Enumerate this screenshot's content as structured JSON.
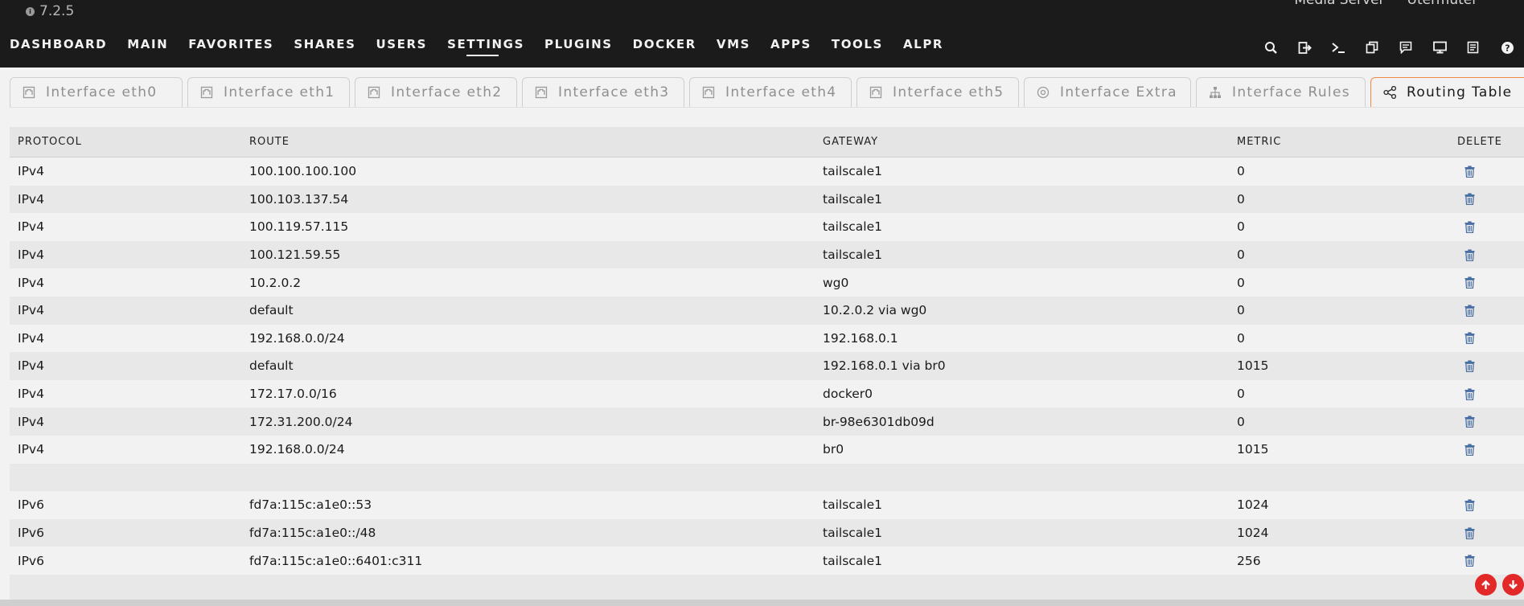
{
  "header": {
    "version": "7.2.5",
    "server_name": "Media Server",
    "server_user": "Utermutel",
    "nav": [
      "DASHBOARD",
      "MAIN",
      "FAVORITES",
      "SHARES",
      "USERS",
      "SETTINGS",
      "PLUGINS",
      "DOCKER",
      "VMS",
      "APPS",
      "TOOLS",
      "ALPR"
    ],
    "nav_active": "SETTINGS",
    "tool_icons": [
      "search-icon",
      "logout-icon",
      "terminal-icon",
      "copy-icon",
      "feedback-icon",
      "display-icon",
      "log-icon",
      "help-icon"
    ]
  },
  "tabs": [
    {
      "label": "Interface eth0",
      "icon": "network-icon"
    },
    {
      "label": "Interface eth1",
      "icon": "network-icon"
    },
    {
      "label": "Interface eth2",
      "icon": "network-icon"
    },
    {
      "label": "Interface eth3",
      "icon": "network-icon"
    },
    {
      "label": "Interface eth4",
      "icon": "network-icon"
    },
    {
      "label": "Interface eth5",
      "icon": "network-icon"
    },
    {
      "label": "Interface Extra",
      "icon": "target-icon"
    },
    {
      "label": "Interface Rules",
      "icon": "sitemap-icon"
    },
    {
      "label": "Routing Table",
      "icon": "share-icon",
      "active": true
    }
  ],
  "table": {
    "headers": [
      "PROTOCOL",
      "ROUTE",
      "GATEWAY",
      "METRIC",
      "DELETE"
    ],
    "rows": [
      {
        "protocol": "IPv4",
        "route": "100.100.100.100",
        "gateway": "tailscale1",
        "metric": "0"
      },
      {
        "protocol": "IPv4",
        "route": "100.103.137.54",
        "gateway": "tailscale1",
        "metric": "0"
      },
      {
        "protocol": "IPv4",
        "route": "100.119.57.115",
        "gateway": "tailscale1",
        "metric": "0"
      },
      {
        "protocol": "IPv4",
        "route": "100.121.59.55",
        "gateway": "tailscale1",
        "metric": "0"
      },
      {
        "protocol": "IPv4",
        "route": "10.2.0.2",
        "gateway": "wg0",
        "metric": "0"
      },
      {
        "protocol": "IPv4",
        "route": "default",
        "gateway": "10.2.0.2 via wg0",
        "metric": "0"
      },
      {
        "protocol": "IPv4",
        "route": "192.168.0.0/24",
        "gateway": "192.168.0.1",
        "metric": "0"
      },
      {
        "protocol": "IPv4",
        "route": "default",
        "gateway": "192.168.0.1 via br0",
        "metric": "1015"
      },
      {
        "protocol": "IPv4",
        "route": "172.17.0.0/16",
        "gateway": "docker0",
        "metric": "0"
      },
      {
        "protocol": "IPv4",
        "route": "172.31.200.0/24",
        "gateway": "br-98e6301db09d",
        "metric": "0"
      },
      {
        "protocol": "IPv4",
        "route": "192.168.0.0/24",
        "gateway": "br0",
        "metric": "1015"
      },
      {
        "spacer": true
      },
      {
        "protocol": "IPv6",
        "route": "fd7a:115c:a1e0::53",
        "gateway": "tailscale1",
        "metric": "1024"
      },
      {
        "protocol": "IPv6",
        "route": "fd7a:115c:a1e0::/48",
        "gateway": "tailscale1",
        "metric": "1024"
      },
      {
        "protocol": "IPv6",
        "route": "fd7a:115c:a1e0::6401:c311",
        "gateway": "tailscale1",
        "metric": "256"
      },
      {
        "spacer": true
      }
    ]
  },
  "colors": {
    "header_bg": "#1c1b1b",
    "accent": "#f08a46",
    "trash": "#4a6fa5",
    "scroll_btn": "#e22828"
  }
}
